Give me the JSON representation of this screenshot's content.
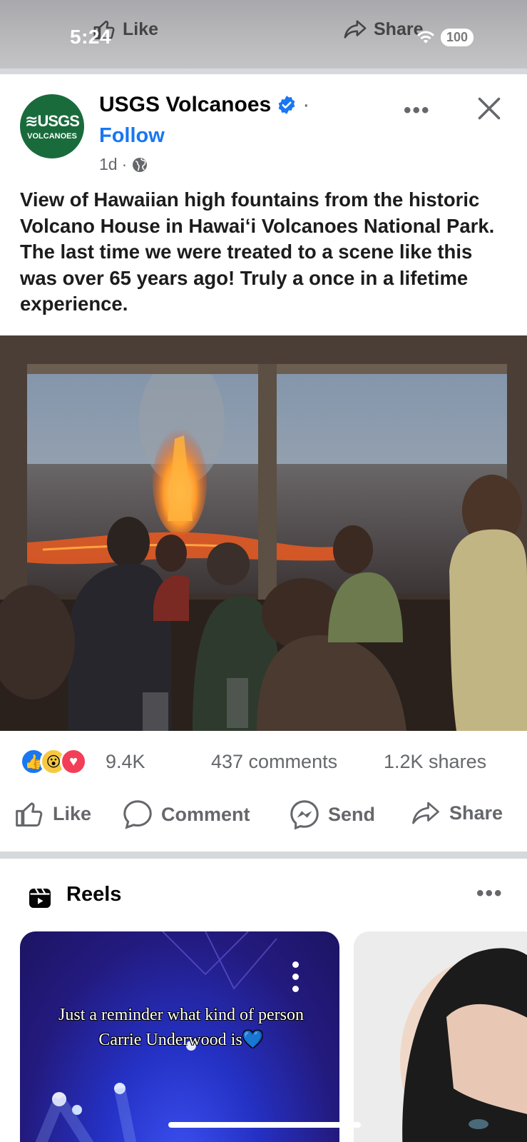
{
  "status": {
    "time": "5:24",
    "battery": "100"
  },
  "sticky_bar": {
    "like_label": "Like",
    "share_label": "Share"
  },
  "post": {
    "page_name": "USGS Volcanoes",
    "avatar": {
      "line1": "≋USGS",
      "line2": "VOLCANOES"
    },
    "follow_label": "Follow",
    "time_ago": "1d",
    "separator": "·",
    "caption": "View of Hawaiian high fountains from the historic Volcano House in Hawaiʻi Volcanoes National Park.  The last time we were treated to a scene like this was over 65 years ago! Truly a once in a lifetime experience.",
    "reaction_count": "9.4K",
    "comments": "437 comments",
    "shares": "1.2K shares"
  },
  "actions": {
    "like": "Like",
    "comment": "Comment",
    "send": "Send",
    "share": "Share"
  },
  "reels": {
    "title": "Reels",
    "items": [
      {
        "text": "Just a reminder what kind of person Carrie Underwood is💙"
      },
      {
        "text": ""
      }
    ]
  },
  "colors": {
    "accent": "#1877f2",
    "muted": "#65676b",
    "usgs_green": "#1a6b3c"
  }
}
